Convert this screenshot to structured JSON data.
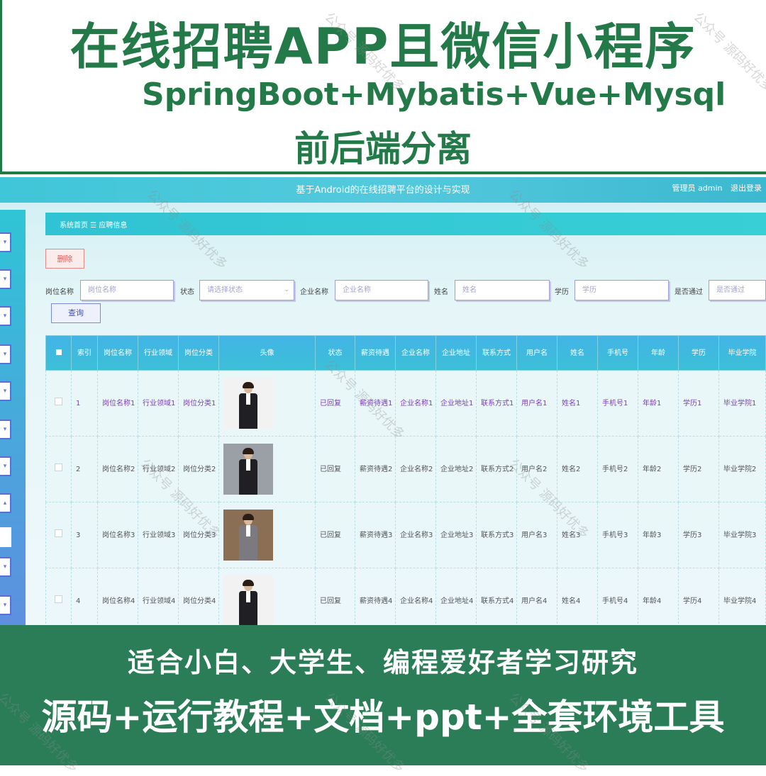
{
  "banner": {
    "title": "在线招聘APP且微信小程序",
    "tech": "SpringBoot+Mybatis+Vue+Mysql",
    "subtitle": "前后端分离"
  },
  "app": {
    "title": "基于Android的在线招聘平台的设计与实现",
    "user_role": "管理员 admin",
    "logout": "退出登录",
    "breadcrumb": "系统首页 ☰ 应聘信息",
    "delete_button": "删除",
    "query_button": "查询",
    "filters": [
      {
        "label": "岗位名称",
        "placeholder": "岗位名称"
      },
      {
        "label": "状态",
        "placeholder": "请选择状态"
      },
      {
        "label": "企业名称",
        "placeholder": "企业名称"
      },
      {
        "label": "姓名",
        "placeholder": "姓名"
      },
      {
        "label": "学历",
        "placeholder": "学历"
      },
      {
        "label": "是否通过",
        "placeholder": "是否通过"
      }
    ],
    "sidebar_icon": "chevron-down-icon",
    "columns": [
      "索引",
      "岗位名称",
      "行业领域",
      "岗位分类",
      "头像",
      "状态",
      "薪资待遇",
      "企业名称",
      "企业地址",
      "联系方式",
      "用户名",
      "姓名",
      "手机号",
      "年龄",
      "学历",
      "毕业学院"
    ],
    "rows": [
      {
        "index": "1",
        "job_name": "岗位名称1",
        "industry": "行业领域1",
        "category": "岗位分类1",
        "status": "已回复",
        "salary": "薪资待遇1",
        "company": "企业名称1",
        "address": "企业地址1",
        "contact": "联系方式1",
        "username": "用户名1",
        "name": "姓名1",
        "phone": "手机号1",
        "age": "年龄1",
        "education": "学历1",
        "college": "毕业学院1"
      },
      {
        "index": "2",
        "job_name": "岗位名称2",
        "industry": "行业领域2",
        "category": "岗位分类2",
        "status": "已回复",
        "salary": "薪资待遇2",
        "company": "企业名称2",
        "address": "企业地址2",
        "contact": "联系方式2",
        "username": "用户名2",
        "name": "姓名2",
        "phone": "手机号2",
        "age": "年龄2",
        "education": "学历2",
        "college": "毕业学院2"
      },
      {
        "index": "3",
        "job_name": "岗位名称3",
        "industry": "行业领域3",
        "category": "岗位分类3",
        "status": "已回复",
        "salary": "薪资待遇3",
        "company": "企业名称3",
        "address": "企业地址3",
        "contact": "联系方式3",
        "username": "用户名3",
        "name": "姓名3",
        "phone": "手机号3",
        "age": "年龄3",
        "education": "学历3",
        "college": "毕业学院3"
      },
      {
        "index": "4",
        "job_name": "岗位名称4",
        "industry": "行业领域4",
        "category": "岗位分类4",
        "status": "已回复",
        "salary": "薪资待遇4",
        "company": "企业名称4",
        "address": "企业地址4",
        "contact": "联系方式4",
        "username": "用户名4",
        "name": "姓名4",
        "phone": "手机号4",
        "age": "年龄4",
        "education": "学历4",
        "college": "毕业学院4"
      }
    ]
  },
  "footer": {
    "line1": "适合小白、大学生、编程爱好者学习研究",
    "line2": "源码+运行教程+文档+ppt+全套环境工具"
  },
  "watermark": "公众号 源码好优多"
}
